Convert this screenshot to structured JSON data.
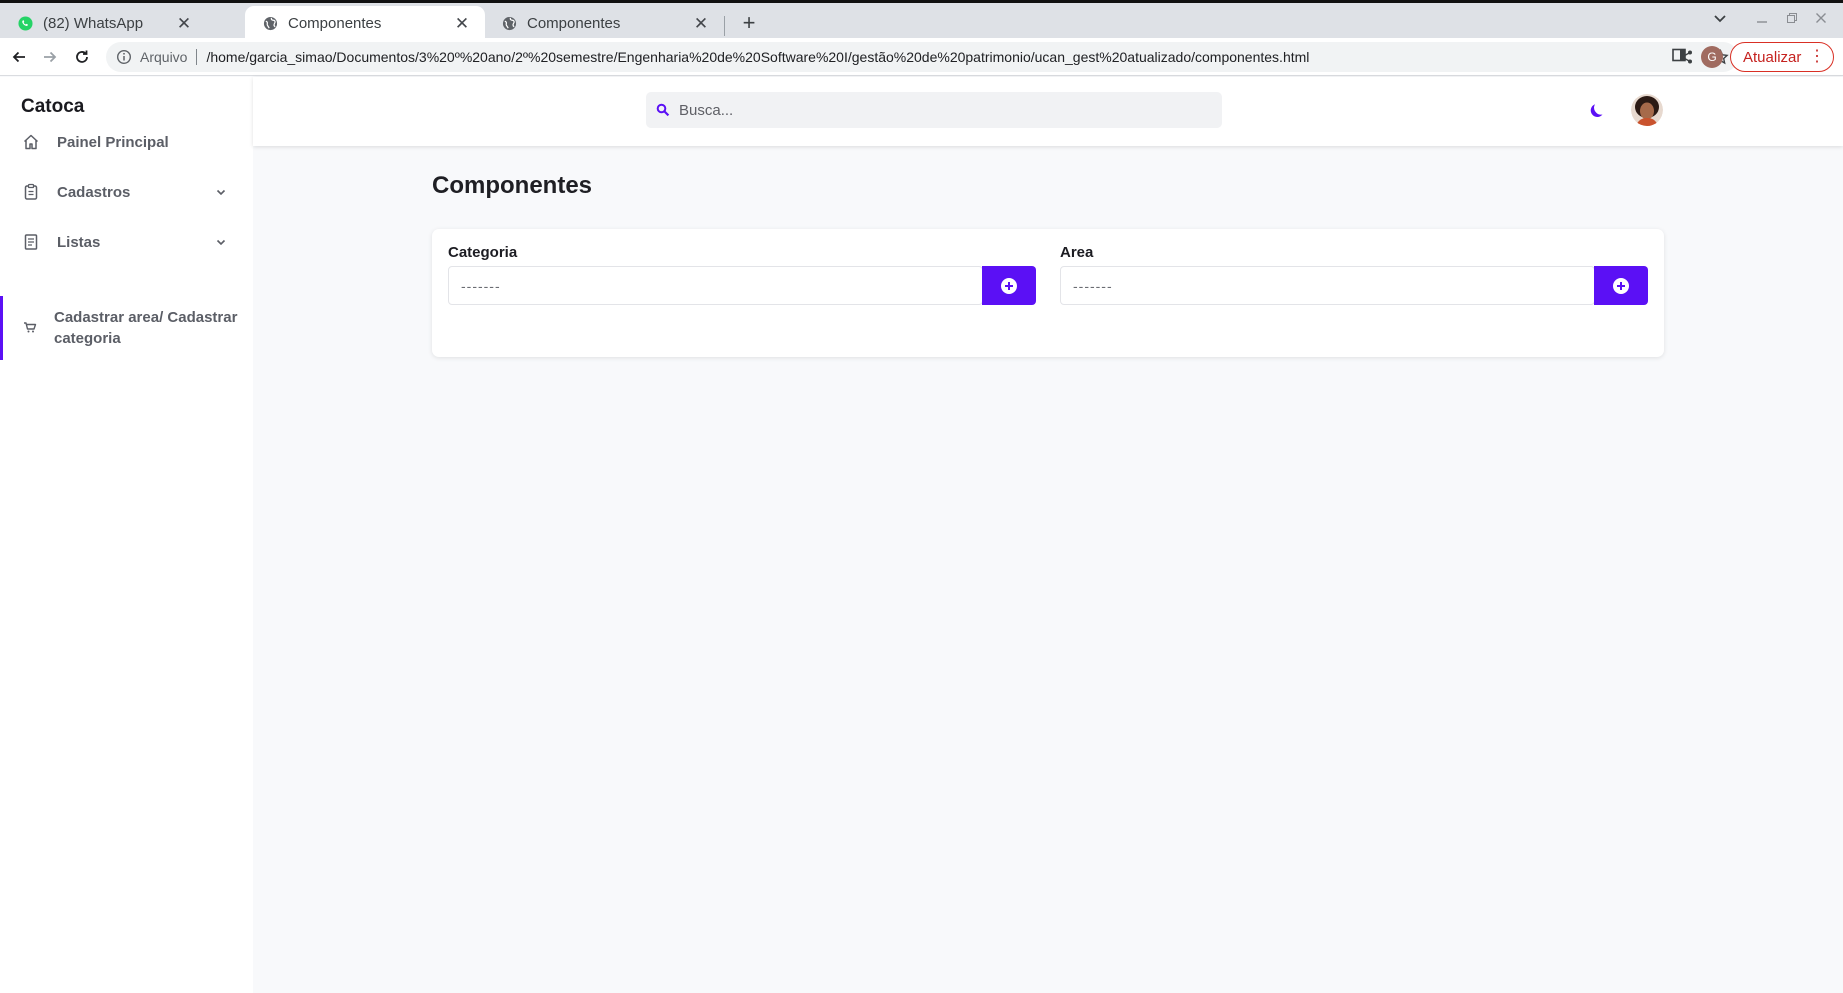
{
  "browser": {
    "tabs": [
      {
        "title": "(82) WhatsApp",
        "icon": "whatsapp-icon",
        "active": false
      },
      {
        "title": "Componentes",
        "icon": "globe-icon",
        "active": true
      },
      {
        "title": "Componentes",
        "icon": "globe-icon",
        "active": false
      }
    ],
    "omnibox": {
      "security_label": "Arquivo",
      "url": "/home/garcia_simao/Documentos/3%20º%20ano/2º%20semestre/Engenharia%20de%20Software%20I/gestão%20de%20patrimonio/ucan_gest%20atualizado/componentes.html"
    },
    "profile_initial": "G",
    "update_label": "Atualizar",
    "colors": {
      "update": "#c5221f",
      "whatsapp": "#25d366"
    }
  },
  "app": {
    "brand": "Catoca",
    "sidebar": {
      "items": [
        {
          "label": "Painel Principal",
          "icon": "home-icon",
          "expandable": false
        },
        {
          "label": "Cadastros",
          "icon": "clipboard-icon",
          "expandable": true
        },
        {
          "label": "Listas",
          "icon": "document-list-icon",
          "expandable": true
        },
        {
          "label": "Cadastrar area/ Cadastrar categoria",
          "icon": "cart-icon",
          "expandable": false,
          "active": true
        }
      ]
    },
    "header": {
      "search_placeholder": "Busca..."
    },
    "main": {
      "title": "Componentes",
      "fields": [
        {
          "label": "Categoria",
          "value": "-------"
        },
        {
          "label": "Area",
          "value": "-------"
        }
      ]
    },
    "colors": {
      "accent": "#5b10f5",
      "background": "#f8f9fb"
    }
  }
}
